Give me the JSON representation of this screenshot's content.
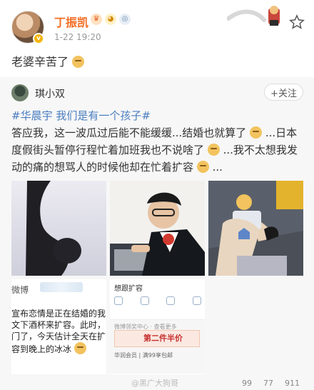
{
  "header": {
    "author": "丁振凯",
    "time": "1-22 19:20",
    "badges": [
      "crown-badge",
      "bear-badge",
      "medal-badge"
    ],
    "verified": "v"
  },
  "post": {
    "text": "老婆辛苦了"
  },
  "repost": {
    "author": "琪小双",
    "follow_label": "+关注",
    "topic": "#华晨宇 我们是有一个孩子#",
    "text_1": "答应我，这一波瓜过后能不能缓缓...结婚也就算了",
    "text_2": "...日本度假街头暂停行程忙着加班我也不说啥了",
    "text_3": "...我不太想我发动的痛的想骂人的时候他却在忙着扩容",
    "text_4": "..."
  },
  "image4": {
    "title": "微博",
    "lines": [
      "宣布恋情是正在结婚的我",
      "文下酒杯来扩容。此时，",
      "门了，今天估计全天在扩",
      "容到晚上的冰冰"
    ]
  },
  "image5": {
    "label": "想跟扩容",
    "ad_top": "微博领奖中心 · 查看更多",
    "ad_title": "第二件半价",
    "ad_line": "华润会员 | 满99享包邮"
  },
  "footer": {
    "watermark": "@黑广大狗哥",
    "stats": [
      "99",
      "77",
      "911"
    ]
  },
  "colors": {
    "accent": "#f36c21",
    "topic": "#4a7dbf",
    "repost_bg": "#f7f7f7"
  }
}
